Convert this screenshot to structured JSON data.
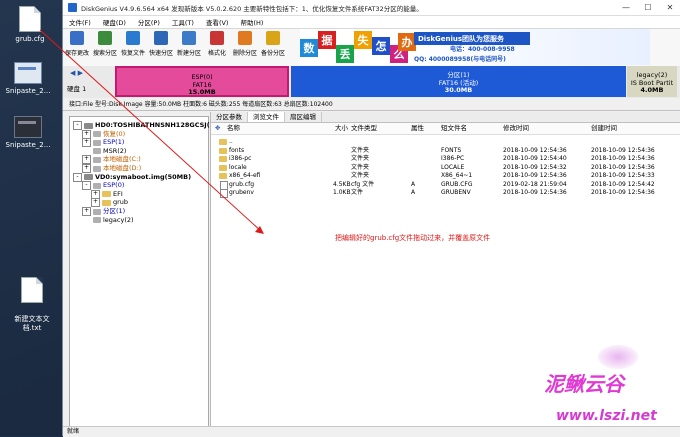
{
  "desktop": {
    "icons": [
      {
        "label": "grub.cfg",
        "kind": "file"
      },
      {
        "label": "Snipaste_2...",
        "kind": "snip"
      },
      {
        "label": "Snipaste_2...",
        "kind": "snip-dark"
      },
      {
        "label": "新建文本文\n档.txt",
        "kind": "file"
      }
    ]
  },
  "window": {
    "title": "DiskGenius V4.9.6.564 x64   发现新版本 V5.0.2.620 主要新特性包括下：1、优化恢复文件系统FAT32分区的能量。",
    "controls": {
      "minimize": "—",
      "maximize": "☐",
      "close": "✕"
    }
  },
  "menu": [
    "文件(F)",
    "硬盘(D)",
    "分区(P)",
    "工具(T)",
    "查看(V)",
    "帮助(H)"
  ],
  "toolbar": [
    {
      "label": "保存更改",
      "color": "#3a6fc6"
    },
    {
      "label": "搜索分区",
      "color": "#3d8b3d"
    },
    {
      "label": "恢复文件",
      "color": "#2a7ad0"
    },
    {
      "label": "快速分区",
      "color": "#2d67b5"
    },
    {
      "label": "新建分区",
      "color": "#3b7bc7"
    },
    {
      "label": "格式化",
      "color": "#c73535"
    },
    {
      "label": "删除分区",
      "color": "#e07a20"
    },
    {
      "label": "备份分区",
      "color": "#d9a418"
    }
  ],
  "banner": {
    "tiles": [
      {
        "ch": "数",
        "color": "#1e8ad8"
      },
      {
        "ch": "据",
        "color": "#d82020"
      },
      {
        "ch": "丢",
        "color": "#19a34a"
      },
      {
        "ch": "失",
        "color": "#f0a000"
      },
      {
        "ch": "怎",
        "color": "#2050c8"
      },
      {
        "ch": "么",
        "color": "#d02080"
      },
      {
        "ch": "办",
        "color": "#e06a10"
      }
    ],
    "brand": "DiskGenius团队为您服务",
    "phone": "电话：400-008-9958",
    "qq": "QQ: 4000089958(与电话同号)"
  },
  "disk": {
    "nav": "◀ ▶",
    "label": "硬盘 1",
    "partitions": [
      {
        "name": "ESP(0)",
        "fs": "FAT16",
        "size": "15.0MB"
      },
      {
        "name": "分区(1)",
        "fs": "FAT16 (活动)",
        "size": "30.0MB"
      },
      {
        "name": "legacy(2)",
        "fs": "IS Boot Partit",
        "size": "4.0MB"
      }
    ],
    "info": "接口:File  型号:Disk Image  容量:50.0MB  柱面数:6  磁头数:255  每道扇区数:63  总扇区数:102400"
  },
  "tree": [
    {
      "label": "HD0:TOSHIBATHNSNH128GCSJ(119GB)",
      "indent": 0,
      "toggle": "-",
      "icon": "disk"
    },
    {
      "label": "恢复(0)",
      "indent": 1,
      "toggle": "+",
      "icon": "part",
      "color": "#c06000"
    },
    {
      "label": "ESP(1)",
      "indent": 1,
      "toggle": "+",
      "icon": "part",
      "color": "#0000c0"
    },
    {
      "label": "MSR(2)",
      "indent": 1,
      "toggle": "",
      "icon": "part",
      "color": "#000000"
    },
    {
      "label": "本地磁盘(C:)",
      "indent": 1,
      "toggle": "+",
      "icon": "part",
      "color": "#c06000"
    },
    {
      "label": "本地磁盘(D:)",
      "indent": 1,
      "toggle": "+",
      "icon": "part",
      "color": "#c06000"
    },
    {
      "label": "VD0:symaboot.img(50MB)",
      "indent": 0,
      "toggle": "-",
      "icon": "disk"
    },
    {
      "label": "ESP(0)",
      "indent": 1,
      "toggle": "-",
      "icon": "part",
      "color": "#0000c0"
    },
    {
      "label": "EFI",
      "indent": 2,
      "toggle": "+",
      "icon": "folder",
      "color": "#000000"
    },
    {
      "label": "grub",
      "indent": 2,
      "toggle": "+",
      "icon": "folder",
      "color": "#000000"
    },
    {
      "label": "分区(1)",
      "indent": 1,
      "toggle": "+",
      "icon": "part",
      "color": "#0000c0"
    },
    {
      "label": "legacy(2)",
      "indent": 1,
      "toggle": "",
      "icon": "part",
      "color": "#000000"
    }
  ],
  "tabs": [
    "分区参数",
    "浏览文件",
    "扇区编辑"
  ],
  "table": {
    "headers": [
      "名称",
      "大小",
      "文件类型",
      "属性",
      "短文件名",
      "修改时间",
      "创建时间"
    ],
    "rows": [
      {
        "name": "..",
        "size": "",
        "type": "",
        "attr": "",
        "short": "",
        "mtime": "",
        "ctime": "",
        "icon": "folder"
      },
      {
        "name": "fonts",
        "size": "",
        "type": "文件夹",
        "attr": "",
        "short": "FONTS",
        "mtime": "2018-10-09 12:54:36",
        "ctime": "2018-10-09 12:54:36",
        "icon": "folder"
      },
      {
        "name": "i386-pc",
        "size": "",
        "type": "文件夹",
        "attr": "",
        "short": "I386-PC",
        "mtime": "2018-10-09 12:54:40",
        "ctime": "2018-10-09 12:54:36",
        "icon": "folder"
      },
      {
        "name": "locale",
        "size": "",
        "type": "文件夹",
        "attr": "",
        "short": "LOCALE",
        "mtime": "2018-10-09 12:54:32",
        "ctime": "2018-10-09 12:54:36",
        "icon": "folder"
      },
      {
        "name": "x86_64-efi",
        "size": "",
        "type": "文件夹",
        "attr": "",
        "short": "X86_64~1",
        "mtime": "2018-10-09 12:54:36",
        "ctime": "2018-10-09 12:54:33",
        "icon": "folder"
      },
      {
        "name": "grub.cfg",
        "size": "4.5KB",
        "type": "cfg 文件",
        "attr": "A",
        "short": "GRUB.CFG",
        "mtime": "2019-02-18 21:59:04",
        "ctime": "2018-10-09 12:54:42",
        "icon": "file"
      },
      {
        "name": "grubenv",
        "size": "1.0KB",
        "type": "文件",
        "attr": "A",
        "short": "GRUBENV",
        "mtime": "2018-10-09 12:54:36",
        "ctime": "2018-10-09 12:54:36",
        "icon": "file"
      }
    ]
  },
  "annotation": "把编辑好的grub.cfg文件拖动过来，并覆盖原文件",
  "status": "就绪",
  "watermark": {
    "line1": "泥鳅云谷",
    "line2": "www.lszi.net"
  }
}
